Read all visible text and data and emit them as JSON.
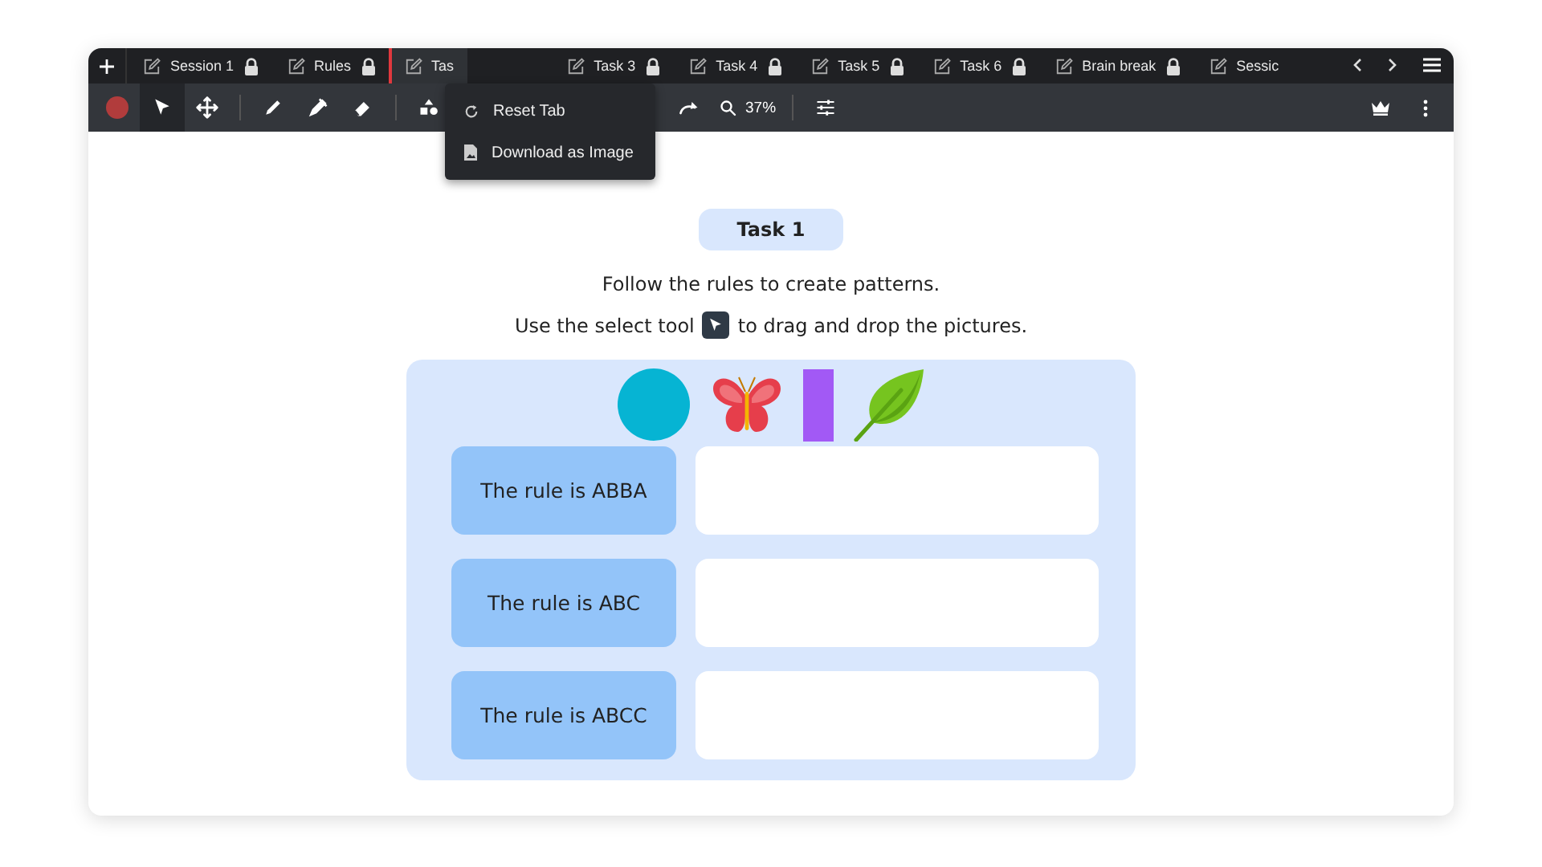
{
  "tabs": [
    {
      "label": "Session 1",
      "selected": false,
      "locked": true
    },
    {
      "label": "Rules",
      "selected": false,
      "locked": true
    },
    {
      "label": "Tas",
      "selected": true,
      "locked": false
    },
    {
      "label": "Task 3",
      "selected": false,
      "locked": true
    },
    {
      "label": "Task 4",
      "selected": false,
      "locked": true
    },
    {
      "label": "Task 5",
      "selected": false,
      "locked": true
    },
    {
      "label": "Task 6",
      "selected": false,
      "locked": true
    },
    {
      "label": "Brain break",
      "selected": false,
      "locked": true
    },
    {
      "label": "Sessic",
      "selected": false,
      "locked": false
    }
  ],
  "toolbar": {
    "tools": [
      {
        "kind": "record",
        "selected": false
      },
      {
        "kind": "select",
        "selected": true
      },
      {
        "kind": "move",
        "selected": false
      },
      {
        "kind": "sep"
      },
      {
        "kind": "pencil",
        "selected": false
      },
      {
        "kind": "marker",
        "selected": false
      },
      {
        "kind": "eraser",
        "selected": false
      },
      {
        "kind": "sep"
      },
      {
        "kind": "shapes",
        "selected": false
      },
      {
        "kind": "gap"
      },
      {
        "kind": "redo",
        "selected": false
      },
      {
        "kind": "zoom",
        "selected": false
      },
      {
        "kind": "sep"
      },
      {
        "kind": "settings",
        "selected": false
      }
    ],
    "zoom": "37%"
  },
  "context_menu": {
    "items": [
      {
        "kind": "reset",
        "label": "Reset Tab"
      },
      {
        "kind": "download",
        "label": "Download as Image"
      }
    ]
  },
  "page": {
    "title": "Task 1",
    "instructions": [
      "Follow the rules to create patterns."
    ],
    "select_line": {
      "before": "Use the select tool",
      "after": "to drag and drop the pictures."
    },
    "pictures": [
      {
        "kind": "circle"
      },
      {
        "kind": "butterfly"
      },
      {
        "kind": "rectangle"
      },
      {
        "kind": "leaf"
      }
    ],
    "rules": [
      {
        "label": "The rule is ABBA"
      },
      {
        "label": "The rule is ABC"
      },
      {
        "label": "The rule is ABCC"
      }
    ]
  }
}
